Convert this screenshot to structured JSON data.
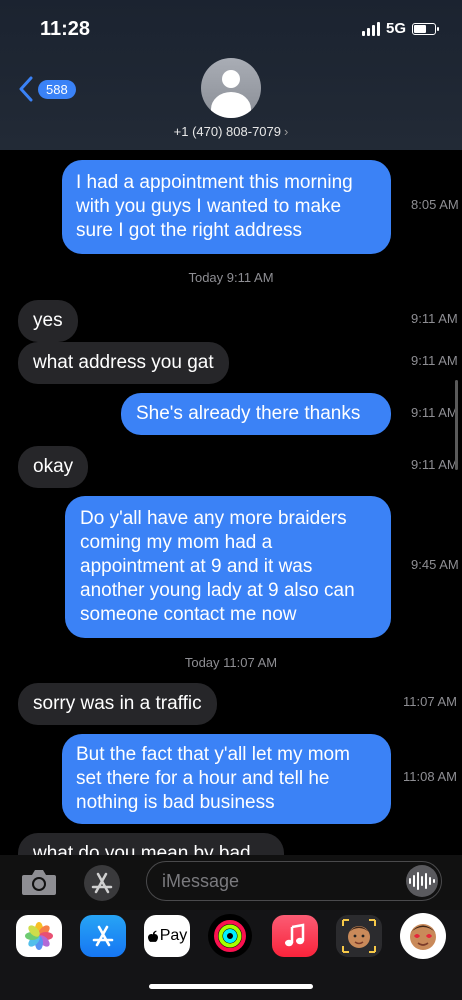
{
  "status": {
    "time": "11:28",
    "network": "5G"
  },
  "header": {
    "back_count": "588",
    "contact": "+1 (470) 808-7079",
    "contact_chevron": "›"
  },
  "messages": [
    {
      "text": "I had a appointment this morning with you guys I wanted to make sure I got the right address",
      "time": "8:05 AM"
    },
    {
      "text": "yes",
      "time": "9:11 AM"
    },
    {
      "text": "what address you gat",
      "time": "9:11 AM"
    },
    {
      "text": "She's already there thanks",
      "time": "9:11 AM"
    },
    {
      "text": "okay",
      "time": "9:11 AM"
    },
    {
      "text": "Do y'all have any more braiders coming my mom had a appointment at 9 and it was another young lady at 9 also can someone contact me now",
      "time": "9:45 AM"
    },
    {
      "text": "sorry was in a traffic",
      "time": "11:07 AM"
    },
    {
      "text": "But the fact that y'all let my mom set there for a hour and tell he nothing is bad business",
      "time": "11:08 AM"
    },
    {
      "text": "what do you mean by bad"
    }
  ],
  "day_labels": [
    {
      "day": "Today",
      "time": "9:11 AM"
    },
    {
      "day": "Today",
      "time": "11:07 AM"
    }
  ],
  "composer": {
    "placeholder": "iMessage"
  },
  "app_bar": {
    "pay_label": "Pay"
  },
  "icons": {
    "camera": "camera-icon",
    "apps": "app-store-icon",
    "audio": "audio-waveform-icon",
    "photos": "photos-icon",
    "app_store": "app-store-icon",
    "apple_pay": "apple-pay-icon",
    "fitness": "activity-rings-icon",
    "music": "music-icon",
    "memoji": "memoji-icon",
    "memoji_stickers": "memoji-stickers-icon"
  },
  "colors": {
    "sent": "#3b82f6",
    "received": "#262629",
    "accent": "#3a82f7"
  }
}
